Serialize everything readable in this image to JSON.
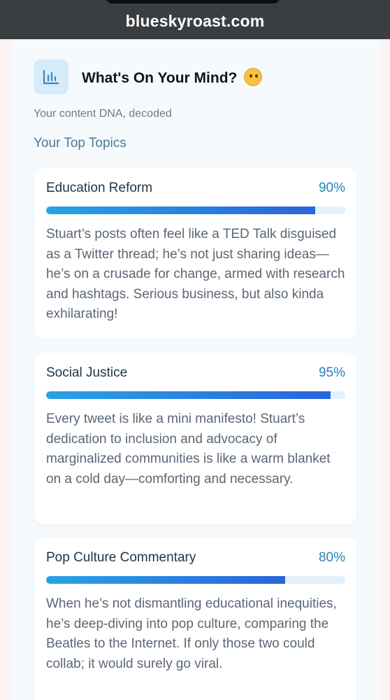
{
  "browser": {
    "domain": "blueskyroast.com"
  },
  "header": {
    "icon": "bar-chart-icon",
    "title": "What's On Your Mind?",
    "emoji": "thinking-face-emoji",
    "subtitle": "Your content DNA, decoded"
  },
  "section": {
    "title": "Your Top Topics"
  },
  "topics": [
    {
      "name": "Education Reform",
      "percent_label": "90%",
      "percent": 90,
      "description": "Stuart’s posts often feel like a TED Talk disguised as a Twitter thread; he’s not just sharing ideas—he’s on a crusade for change, armed with research and hashtags. Serious business, but also kinda exhilarating!"
    },
    {
      "name": "Social Justice",
      "percent_label": "95%",
      "percent": 95,
      "description": "Every tweet is like a mini manifesto! Stuart’s dedication to inclusion and advocacy of marginalized communities is like a warm blanket on a cold day—comforting and necessary."
    },
    {
      "name": "Pop Culture Commentary",
      "percent_label": "80%",
      "percent": 80,
      "description": "When he’s not dismantling educational inequities, he’s deep-diving into pop culture, comparing the Beatles to the Internet. If only those two could collab; it would surely go viral."
    }
  ],
  "colors": {
    "bar_start": "#28a3e6",
    "bar_end": "#2a64dc",
    "bar_track": "#e4f1fb",
    "percent_text": "#2585b8",
    "section_title": "#4a7b95"
  }
}
